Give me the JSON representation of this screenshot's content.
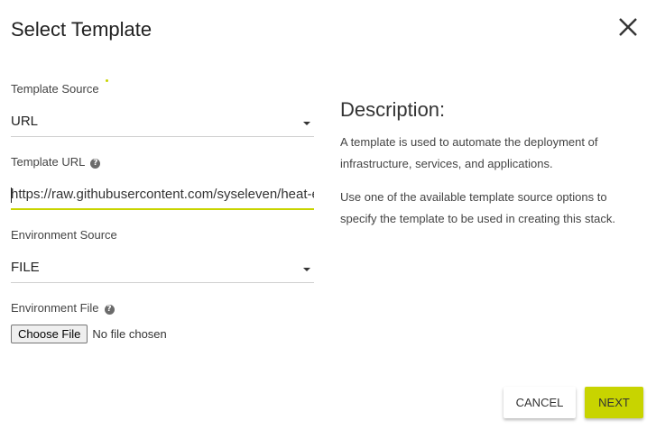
{
  "dialog": {
    "title": "Select Template"
  },
  "form": {
    "template_source": {
      "label": "Template Source",
      "value": "URL"
    },
    "template_url": {
      "label": "Template URL",
      "value": "https://raw.githubusercontent.com/syseleven/heat-examples"
    },
    "environment_source": {
      "label": "Environment Source",
      "value": "FILE"
    },
    "environment_file": {
      "label": "Environment File",
      "button_label": "Choose File",
      "status": "No file chosen"
    },
    "help_glyph": "?"
  },
  "description": {
    "title": "Description:",
    "paragraph_1": "A template is used to automate the deployment of infrastructure, services, and applications.",
    "paragraph_2": "Use one of the available template source options to specify the template to be used in creating this stack."
  },
  "actions": {
    "cancel_label": "CANCEL",
    "next_label": "NEXT"
  },
  "colors": {
    "accent": "#c8d400",
    "text": "#333333"
  },
  "icons": {
    "close": "close-icon",
    "help": "help-icon",
    "dropdown": "caret-down-icon"
  }
}
